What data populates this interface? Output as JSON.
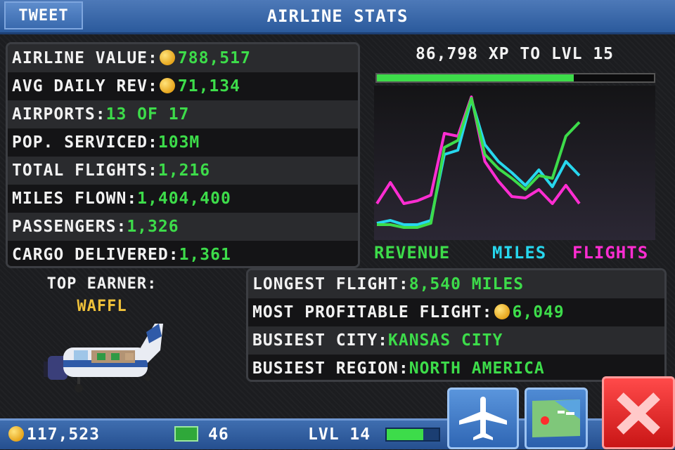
{
  "header": {
    "tweet_label": "TWEET",
    "title": "AIRLINE STATS"
  },
  "stats": [
    {
      "label": "AIRLINE VALUE:",
      "coin": true,
      "value": "788,517"
    },
    {
      "label": "AVG DAILY REV:",
      "coin": true,
      "value": "71,134"
    },
    {
      "label": "AIRPORTS:",
      "coin": false,
      "value": "13 OF 17"
    },
    {
      "label": "POP. SERVICED:",
      "coin": false,
      "value": "103M"
    },
    {
      "label": "TOTAL FLIGHTS:",
      "coin": false,
      "value": "1,216"
    },
    {
      "label": "MILES FLOWN:",
      "coin": false,
      "value": "1,404,400"
    },
    {
      "label": "PASSENGERS:",
      "coin": false,
      "value": "1,326"
    },
    {
      "label": "CARGO DELIVERED:",
      "coin": false,
      "value": "1,361"
    }
  ],
  "xp": {
    "text": "86,798 XP TO LVL 15",
    "progress": 0.71
  },
  "graph": {
    "colors": {
      "revenue": "#3ddc4a",
      "miles": "#27d7ee",
      "flights": "#ff2dd2"
    },
    "revenue": [
      5,
      5,
      3,
      3,
      6,
      60,
      65,
      95,
      55,
      45,
      38,
      30,
      40,
      38,
      68,
      78
    ],
    "miles": [
      6,
      8,
      5,
      5,
      8,
      55,
      58,
      94,
      62,
      50,
      42,
      33,
      44,
      32,
      50,
      40
    ],
    "flights": [
      20,
      35,
      20,
      22,
      26,
      70,
      68,
      96,
      50,
      36,
      25,
      24,
      30,
      20,
      33,
      20
    ]
  },
  "legend": {
    "revenue": "REVENUE",
    "miles": "MILES",
    "flights": "FLIGHTS"
  },
  "top_earner": {
    "label": "TOP EARNER:",
    "name": "WAFFL"
  },
  "records": [
    {
      "label": "LONGEST FLIGHT:",
      "coin": false,
      "value": "8,540 MILES"
    },
    {
      "label": "MOST PROFITABLE FLIGHT:",
      "coin": true,
      "value": "6,049"
    },
    {
      "label": "BUSIEST CITY:",
      "coin": false,
      "value": "KANSAS CITY"
    },
    {
      "label": "BUSIEST REGION:",
      "coin": false,
      "value": "NORTH AMERICA"
    }
  ],
  "bottom_bar": {
    "coins": "117,523",
    "bux": "46",
    "level": "LVL 14",
    "level_progress": 0.7
  }
}
